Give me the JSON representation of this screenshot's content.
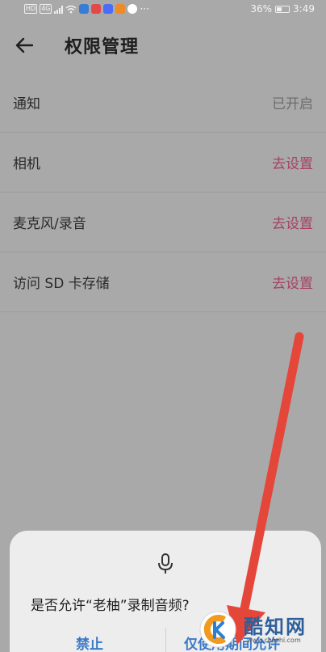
{
  "status_bar": {
    "left_badges": [
      "HD",
      "4G"
    ],
    "battery": "36%",
    "time": "3:49",
    "app_icon_colors": [
      "#3a7bd5",
      "#e24a4a",
      "#4a6cf7",
      "#f08a24",
      "#ffffff"
    ]
  },
  "header": {
    "back_icon": "arrow-left-icon",
    "title": "权限管理"
  },
  "permissions": [
    {
      "label": "通知",
      "status": "已开启",
      "state": "enabled"
    },
    {
      "label": "相机",
      "status": "去设置",
      "state": "action"
    },
    {
      "label": "麦克风/录音",
      "status": "去设置",
      "state": "action"
    },
    {
      "label": "访问 SD 卡存储",
      "status": "去设置",
      "state": "action"
    }
  ],
  "dialog": {
    "icon": "microphone-icon",
    "question": "是否允许“老柚”录制音频?",
    "deny_label": "禁止",
    "allow_label": "仅使用期间允许"
  },
  "annotation": {
    "type": "arrow",
    "color": "#e5463a"
  },
  "watermark": {
    "name": "酷知网",
    "url": "www.coozhi.com"
  },
  "colors": {
    "overlay_background": "#a9a9a9",
    "action_text": "#a64262",
    "dialog_button": "#3b79c7"
  }
}
